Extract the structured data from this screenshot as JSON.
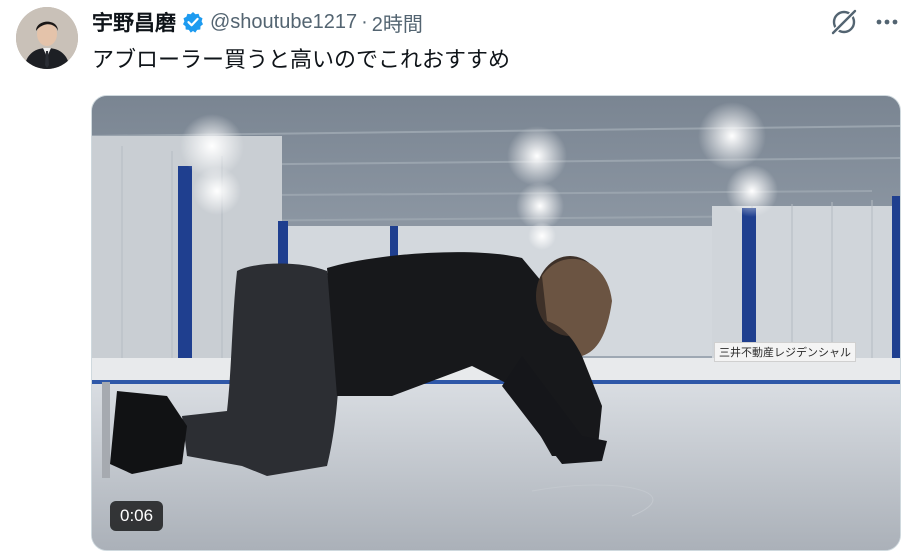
{
  "user": {
    "display_name": "宇野昌磨",
    "handle": "@shoutube1217",
    "separator": "·",
    "time": "2時間"
  },
  "tweet": {
    "text": "アブローラー買うと高いのでこれおすすめ"
  },
  "media": {
    "duration": "0:06",
    "sign_text": "三井不動産レジデンシャル"
  },
  "icons": {
    "verified": "verified-badge-icon",
    "grok": "grok-icon",
    "more": "more-icon"
  },
  "colors": {
    "verified": "#1d9bf0",
    "name": "#0f1419",
    "secondary": "#536471"
  }
}
